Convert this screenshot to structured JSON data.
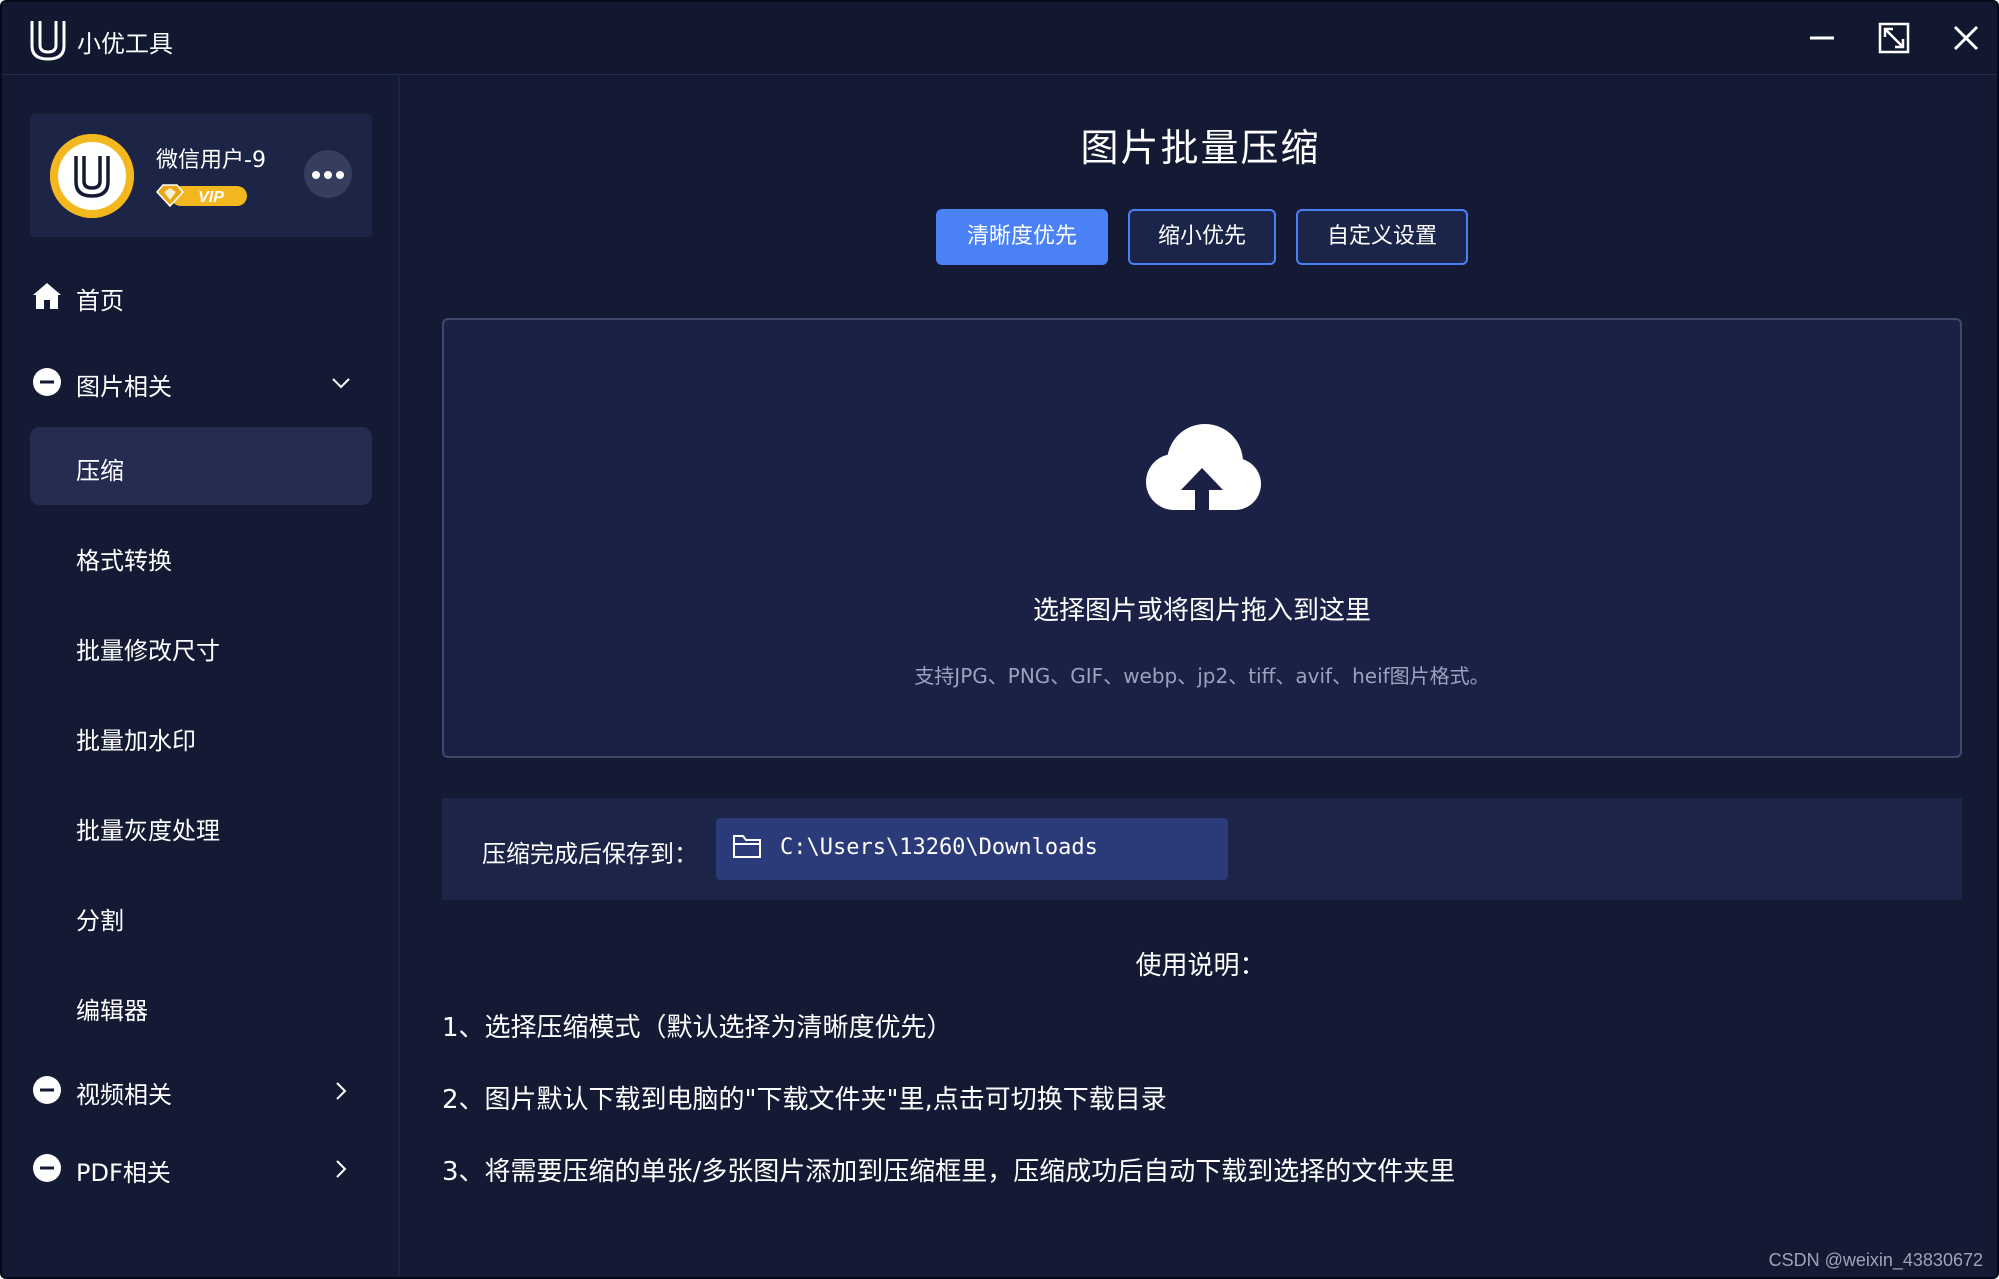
{
  "app": {
    "title": "小优工具"
  },
  "window_controls": {
    "minimize": "minimize-icon",
    "maximize": "maximize-icon",
    "close": "close-icon"
  },
  "user": {
    "name": "微信用户-9",
    "badge": "VIP"
  },
  "sidebar": {
    "home": "首页",
    "image_group": "图片相关",
    "image_items": [
      "压缩",
      "格式转换",
      "批量修改尺寸",
      "批量加水印",
      "批量灰度处理",
      "分割",
      "编辑器"
    ],
    "active_item": "压缩",
    "video_group": "视频相关",
    "pdf_group": "PDF相关"
  },
  "main": {
    "title": "图片批量压缩",
    "modes": [
      "清晰度优先",
      "缩小优先",
      "自定义设置"
    ],
    "selected_mode": "清晰度优先",
    "dropzone": {
      "title": "选择图片或将图片拖入到这里",
      "subtitle": "支持JPG、PNG、GIF、webp、jp2、tiff、avif、heif图片格式。"
    },
    "save": {
      "label": "压缩完成后保存到：",
      "path": "C:\\Users\\13260\\Downloads"
    },
    "usage": {
      "title": "使用说明：",
      "lines": [
        "1、选择压缩模式（默认选择为清晰度优先）",
        "2、图片默认下载到电脑的\"下载文件夹\"里,点击可切换下载目录",
        "3、将需要压缩的单张/多张图片添加到压缩框里，压缩成功后自动下载到选择的文件夹里"
      ]
    }
  },
  "watermark": "CSDN @weixin_43830672",
  "colors": {
    "background": "#141a33",
    "accent": "#4a82f6",
    "vip_gold": "#f3b71f"
  }
}
